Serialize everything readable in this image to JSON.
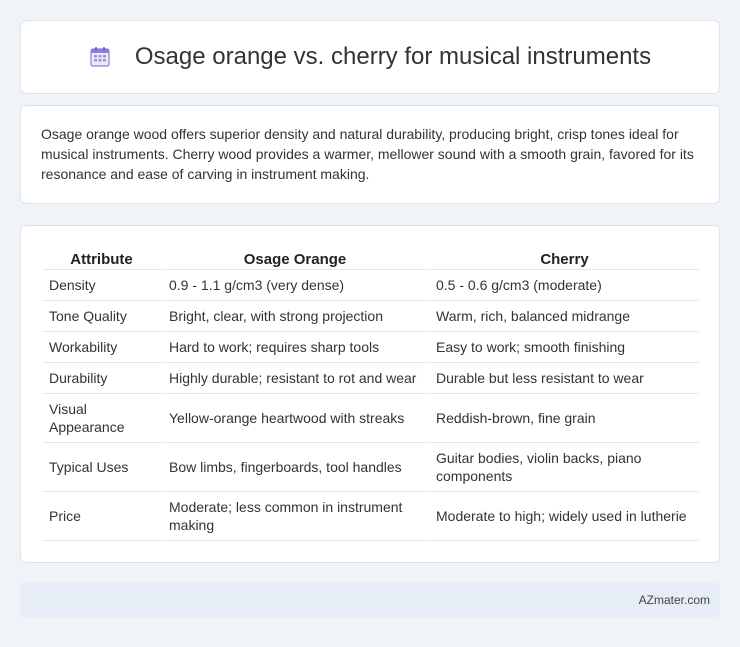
{
  "header": {
    "title": "Osage orange vs. cherry for musical instruments",
    "icon": "calendar-icon"
  },
  "intro": {
    "text": "Osage orange wood offers superior density and natural durability, producing bright, crisp tones ideal for musical instruments. Cherry wood provides a warmer, mellower sound with a smooth grain, favored for its resonance and ease of carving in instrument making."
  },
  "table": {
    "headers": [
      "Attribute",
      "Osage Orange",
      "Cherry"
    ],
    "rows": [
      [
        "Density",
        "0.9 - 1.1 g/cm3 (very dense)",
        "0.5 - 0.6 g/cm3 (moderate)"
      ],
      [
        "Tone Quality",
        "Bright, clear, with strong projection",
        "Warm, rich, balanced midrange"
      ],
      [
        "Workability",
        "Hard to work; requires sharp tools",
        "Easy to work; smooth finishing"
      ],
      [
        "Durability",
        "Highly durable; resistant to rot and wear",
        "Durable but less resistant to wear"
      ],
      [
        "Visual Appearance",
        "Yellow-orange heartwood with streaks",
        "Reddish-brown, fine grain"
      ],
      [
        "Typical Uses",
        "Bow limbs, fingerboards, tool handles",
        "Guitar bodies, violin backs, piano components"
      ],
      [
        "Price",
        "Moderate; less common in instrument making",
        "Moderate to high; widely used in lutherie"
      ]
    ]
  },
  "footer": {
    "text": "AZmater.com"
  },
  "colors": {
    "background": "#f0f3f8",
    "card": "#ffffff",
    "footer_bg": "#e6edf7",
    "icon_accent": "#7b6fd6"
  }
}
